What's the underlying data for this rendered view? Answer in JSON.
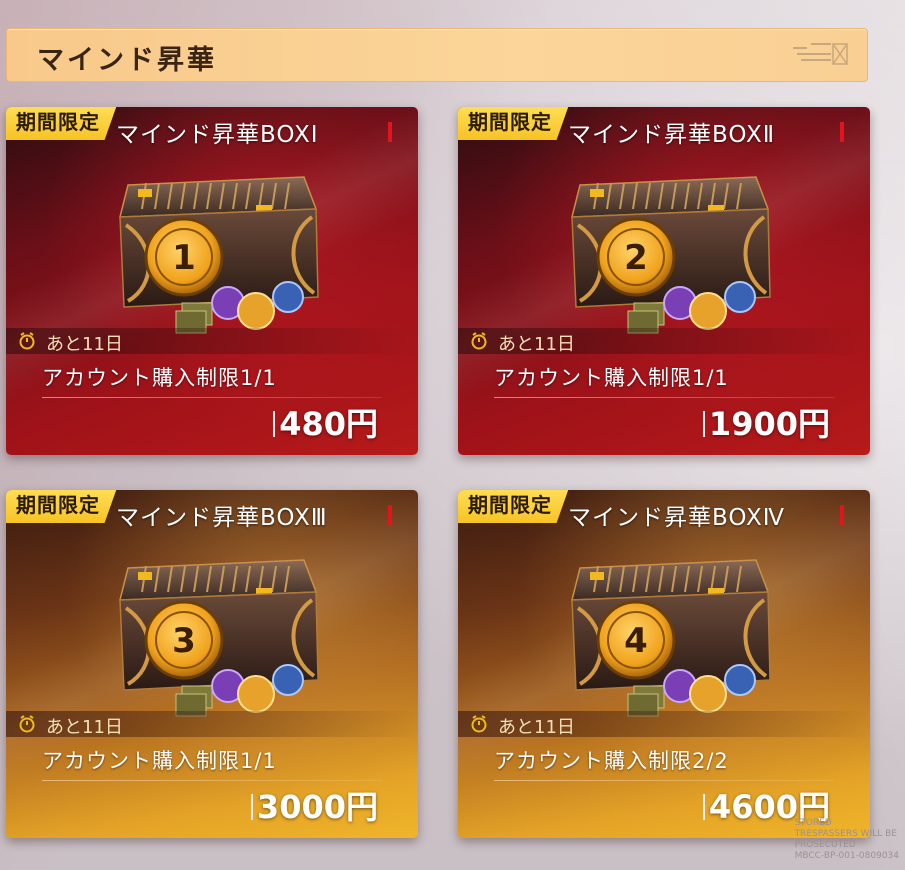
{
  "header": {
    "title": "マインド昇華"
  },
  "cards": [
    {
      "tag": "期間限定",
      "name": "マインド昇華BOXⅠ",
      "chest_number": "1",
      "remaining": "あと11日",
      "limit": "アカウント購入制限1/1",
      "price": "480円",
      "theme": "red"
    },
    {
      "tag": "期間限定",
      "name": "マインド昇華BOXⅡ",
      "chest_number": "2",
      "remaining": "あと11日",
      "limit": "アカウント購入制限1/1",
      "price": "1900円",
      "theme": "red"
    },
    {
      "tag": "期間限定",
      "name": "マインド昇華BOXⅢ",
      "chest_number": "3",
      "remaining": "あと11日",
      "limit": "アカウント購入制限1/1",
      "price": "3000円",
      "theme": "gold"
    },
    {
      "tag": "期間限定",
      "name": "マインド昇華BOXⅣ",
      "chest_number": "4",
      "remaining": "あと11日",
      "limit": "アカウント購入制限2/2",
      "price": "4600円",
      "theme": "gold"
    }
  ],
  "watermark": {
    "lines": [
      "STORED",
      "TRESPASSERS WILL BE",
      "PROSECUTED",
      "MBCC-BP-001-0809034"
    ]
  },
  "colors": {
    "tag_yellow": "#f7c326",
    "red_card": "#9e1219",
    "gold_card": "#e4a327",
    "header_bg": "#fbd59a"
  },
  "icons": {
    "timer": "alarm-clock-icon",
    "header_deco": "panel-deco-icon"
  }
}
